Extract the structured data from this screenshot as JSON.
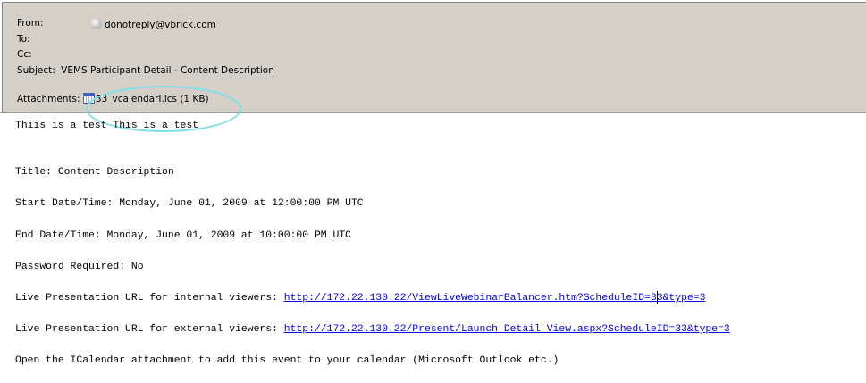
{
  "header": {
    "from_label": "From:",
    "from_value": "donotreply@vbrick.com",
    "to_label": "To:",
    "cc_label": "Cc:",
    "subject_label": "Subject:",
    "subject_value": "VEMS Participant Detail - Content Description",
    "attachments_label": "Attachments:",
    "attachment_name": "33_vcalendarI.ics (1 KB)"
  },
  "body": {
    "line1": "Thiis is a test This is a test",
    "title": "Title: Content Description",
    "start": "Start Date/Time: Monday, June 01, 2009 at 12:00:00 PM UTC",
    "end": "End Date/Time: Monday, June 01, 2009 at 10:00:00 PM UTC",
    "password": "Password Required: No",
    "internal_label": "Live Presentation URL for internal viewers: ",
    "internal_url": "http://172.22.130.22/ViewLiveWebinarBalancer.htm?ScheduleID=33&type=3",
    "external_label": "Live Presentation URL for external viewers: ",
    "external_url": "http://172.22.130.22/Present/Launch Detail View.aspx?ScheduleID=33&type=3",
    "calendar_note": "Open the ICalendar attachment to add this event to your calendar (Microsoft Outlook etc.)"
  },
  "colors": {
    "header_bg": "#d4d0c8",
    "link": "#0000ee",
    "highlight_ring": "#7fe0ea"
  },
  "icons": {
    "sender": "avatar-icon",
    "attachment": "ics-calendar-icon"
  }
}
